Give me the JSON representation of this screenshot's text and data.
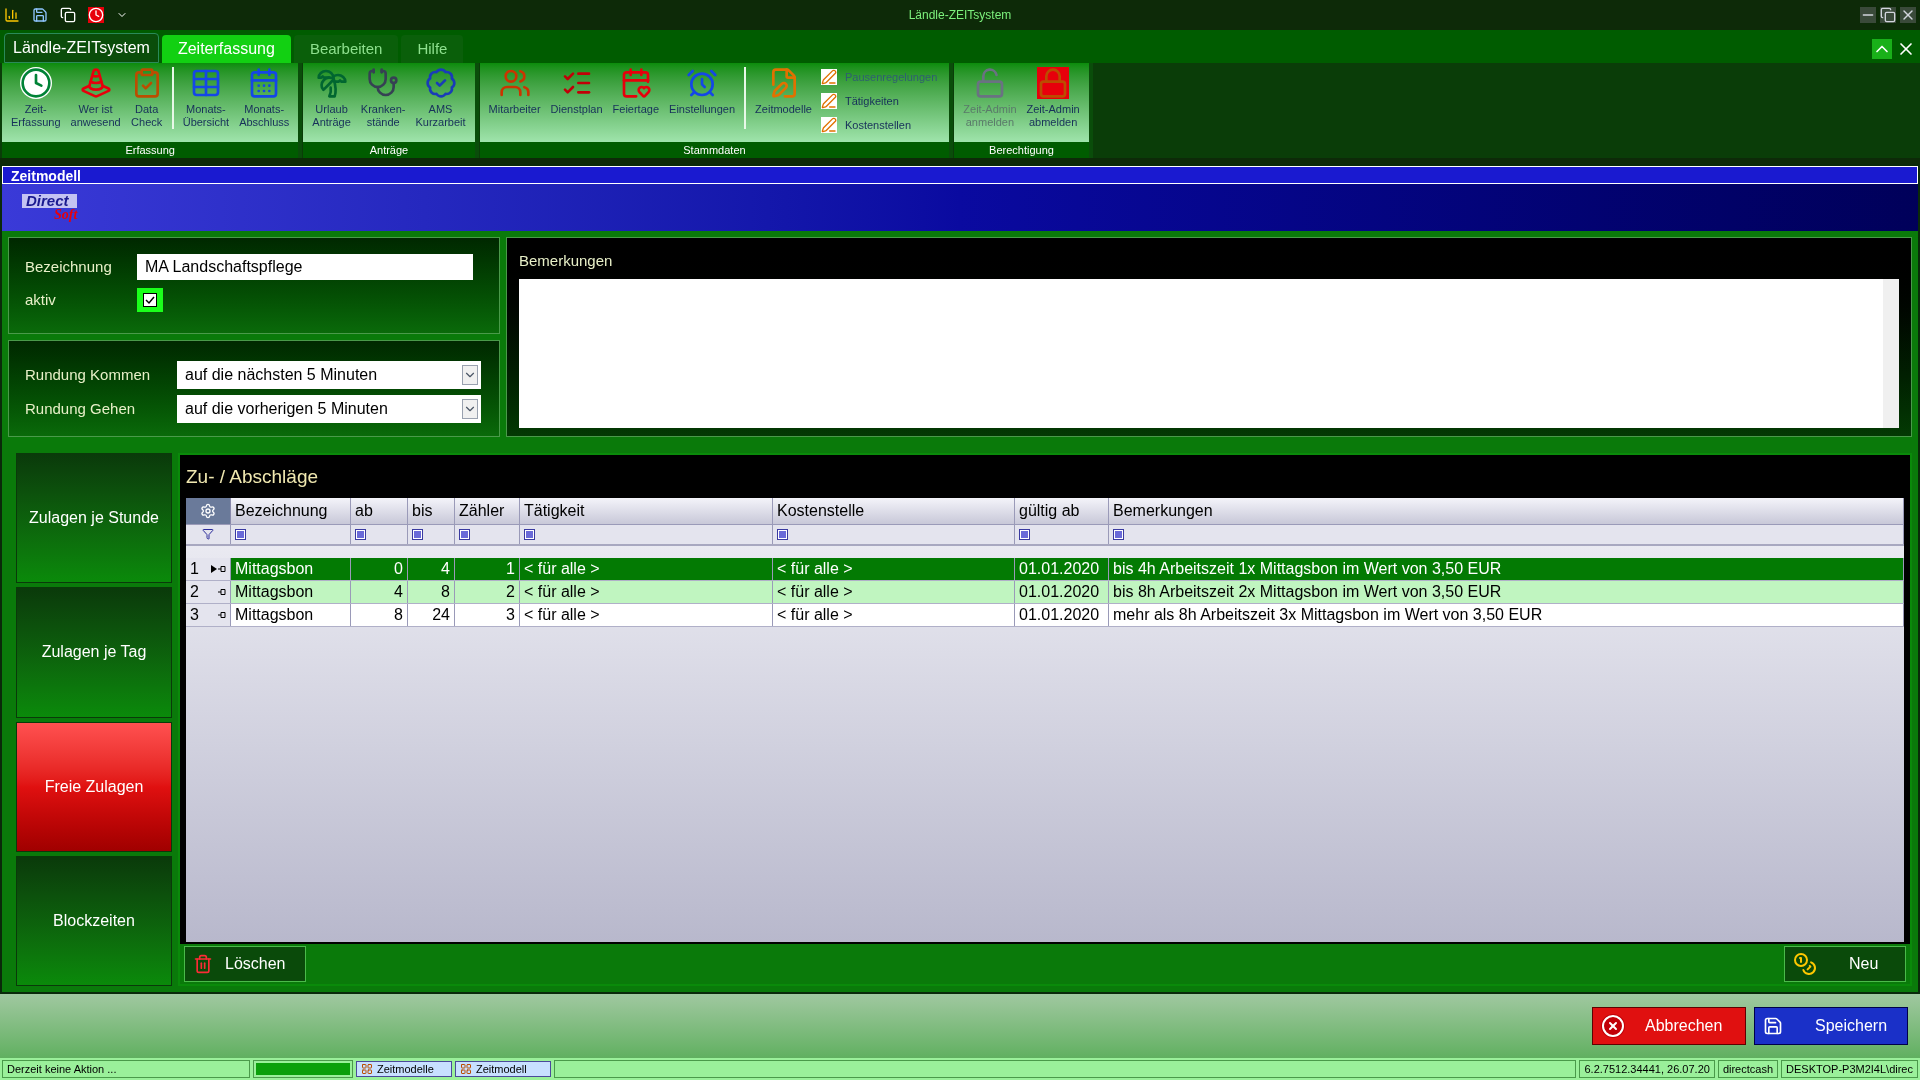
{
  "window": {
    "title": "Ländle-ZEITsystem"
  },
  "menu_tabs": [
    {
      "label": "Ländle-ZEITsystem",
      "kind": "app"
    },
    {
      "label": "Zeiterfassung",
      "kind": "tab",
      "selected": true
    },
    {
      "label": "Bearbeiten",
      "kind": "tab",
      "selected": false
    },
    {
      "label": "Hilfe",
      "kind": "tab",
      "selected": false
    }
  ],
  "ribbon": [
    {
      "label": "Erfassung",
      "items": [
        {
          "kind": "large",
          "lines": [
            "Zeit-",
            "Erfassung"
          ],
          "disabled": false
        },
        {
          "kind": "large",
          "lines": [
            "Wer ist",
            "anwesend"
          ],
          "disabled": false
        },
        {
          "kind": "large",
          "lines": [
            "Data",
            "Check"
          ],
          "disabled": false
        },
        {
          "kind": "separator"
        },
        {
          "kind": "large",
          "lines": [
            "Monats-",
            "Übersicht"
          ],
          "disabled": false
        },
        {
          "kind": "large",
          "lines": [
            "Monats-",
            "Abschluss"
          ],
          "disabled": false
        }
      ]
    },
    {
      "label": "Anträge",
      "items": [
        {
          "kind": "large",
          "lines": [
            "Urlaub",
            "Anträge"
          ],
          "disabled": false
        },
        {
          "kind": "large",
          "lines": [
            "Kranken-",
            "stände"
          ],
          "disabled": false
        },
        {
          "kind": "large",
          "lines": [
            "AMS",
            "Kurzarbeit"
          ],
          "disabled": false
        }
      ]
    },
    {
      "label": "Stammdaten",
      "items": [
        {
          "kind": "large",
          "lines": [
            "Mitarbeiter"
          ],
          "disabled": false
        },
        {
          "kind": "large",
          "lines": [
            "Dienstplan"
          ],
          "disabled": false
        },
        {
          "kind": "large",
          "lines": [
            "Feiertage"
          ],
          "disabled": false
        },
        {
          "kind": "large",
          "lines": [
            "Einstellungen"
          ],
          "disabled": false
        },
        {
          "kind": "separator"
        },
        {
          "kind": "large",
          "lines": [
            "Zeitmodelle"
          ],
          "disabled": false
        },
        {
          "kind": "small",
          "lines": [
            "Pausenregelungen"
          ],
          "disabled": true
        },
        {
          "kind": "small",
          "lines": [
            "Tätigkeiten"
          ],
          "disabled": false
        },
        {
          "kind": "small",
          "lines": [
            "Kostenstellen"
          ],
          "disabled": false
        }
      ]
    },
    {
      "label": "Berechtigung",
      "items": [
        {
          "kind": "large",
          "lines": [
            "Zeit-Admin",
            "anmelden"
          ],
          "disabled": true
        },
        {
          "kind": "large",
          "lines": [
            "Zeit-Admin",
            "abmelden"
          ],
          "disabled": false
        }
      ]
    }
  ],
  "form_window": {
    "title": "Zeitmodell",
    "logo": [
      "Direct",
      "Soft"
    ]
  },
  "form": {
    "bezeichnung_label": "Bezeichnung",
    "bezeichnung_value": "MA Landschaftspflege",
    "aktiv_label": "aktiv",
    "aktiv_checked": true,
    "rundung_kommen_label": "Rundung Kommen",
    "rundung_kommen_value": "auf die nächsten 5 Minuten",
    "rundung_gehen_label": "Rundung Gehen",
    "rundung_gehen_value": "auf die vorherigen 5 Minuten",
    "bemerkungen_label": "Bemerkungen"
  },
  "side_buttons": [
    {
      "label": "Zulagen je Stunde",
      "selected": false
    },
    {
      "label": "Zulagen je Tag",
      "selected": false
    },
    {
      "label": "Freie Zulagen",
      "selected": true
    },
    {
      "label": "Blockzeiten",
      "selected": false
    }
  ],
  "table": {
    "title": "Zu- / Abschläge",
    "columns": [
      {
        "label": "Bezeichnung"
      },
      {
        "label": "ab"
      },
      {
        "label": "bis"
      },
      {
        "label": "Zähler"
      },
      {
        "label": "Tätigkeit"
      },
      {
        "label": "Kostenstelle"
      },
      {
        "label": "gültig ab"
      },
      {
        "label": "Bemerkungen"
      }
    ],
    "rows": [
      {
        "number": "1",
        "selected": true,
        "cells": [
          "Mittagsbon",
          "0",
          "4",
          "1",
          "< für alle >",
          "< für alle >",
          "01.01.2020",
          "bis 4h Arbeitszeit 1x Mittagsbon im Wert von 3,50 EUR"
        ]
      },
      {
        "number": "2",
        "selected": false,
        "cells": [
          "Mittagsbon",
          "4",
          "8",
          "2",
          "< für alle >",
          "< für alle >",
          "01.01.2020",
          "bis 8h Arbeitszeit 2x Mittagsbon im Wert von 3,50 EUR"
        ]
      },
      {
        "number": "3",
        "selected": false,
        "cells": [
          "Mittagsbon",
          "8",
          "24",
          "3",
          "< für alle >",
          "< für alle >",
          "01.01.2020",
          "mehr als 8h Arbeitszeit 3x Mittagsbon im Wert von 3,50 EUR"
        ]
      }
    ],
    "delete_button": "Löschen",
    "new_button": "Neu"
  },
  "footer_buttons": {
    "cancel": "Abbrechen",
    "save": "Speichern"
  },
  "status_bar": {
    "message": "Derzeit keine Aktion ...",
    "progress": {
      "level": 1
    },
    "tabs": [
      "Zeitmodelle",
      "Zeitmodell"
    ],
    "version": "6.2.7512.34441, 26.07.20",
    "user": "directcash",
    "machine": "DESKTOP-P3M2I4L\\direc"
  }
}
